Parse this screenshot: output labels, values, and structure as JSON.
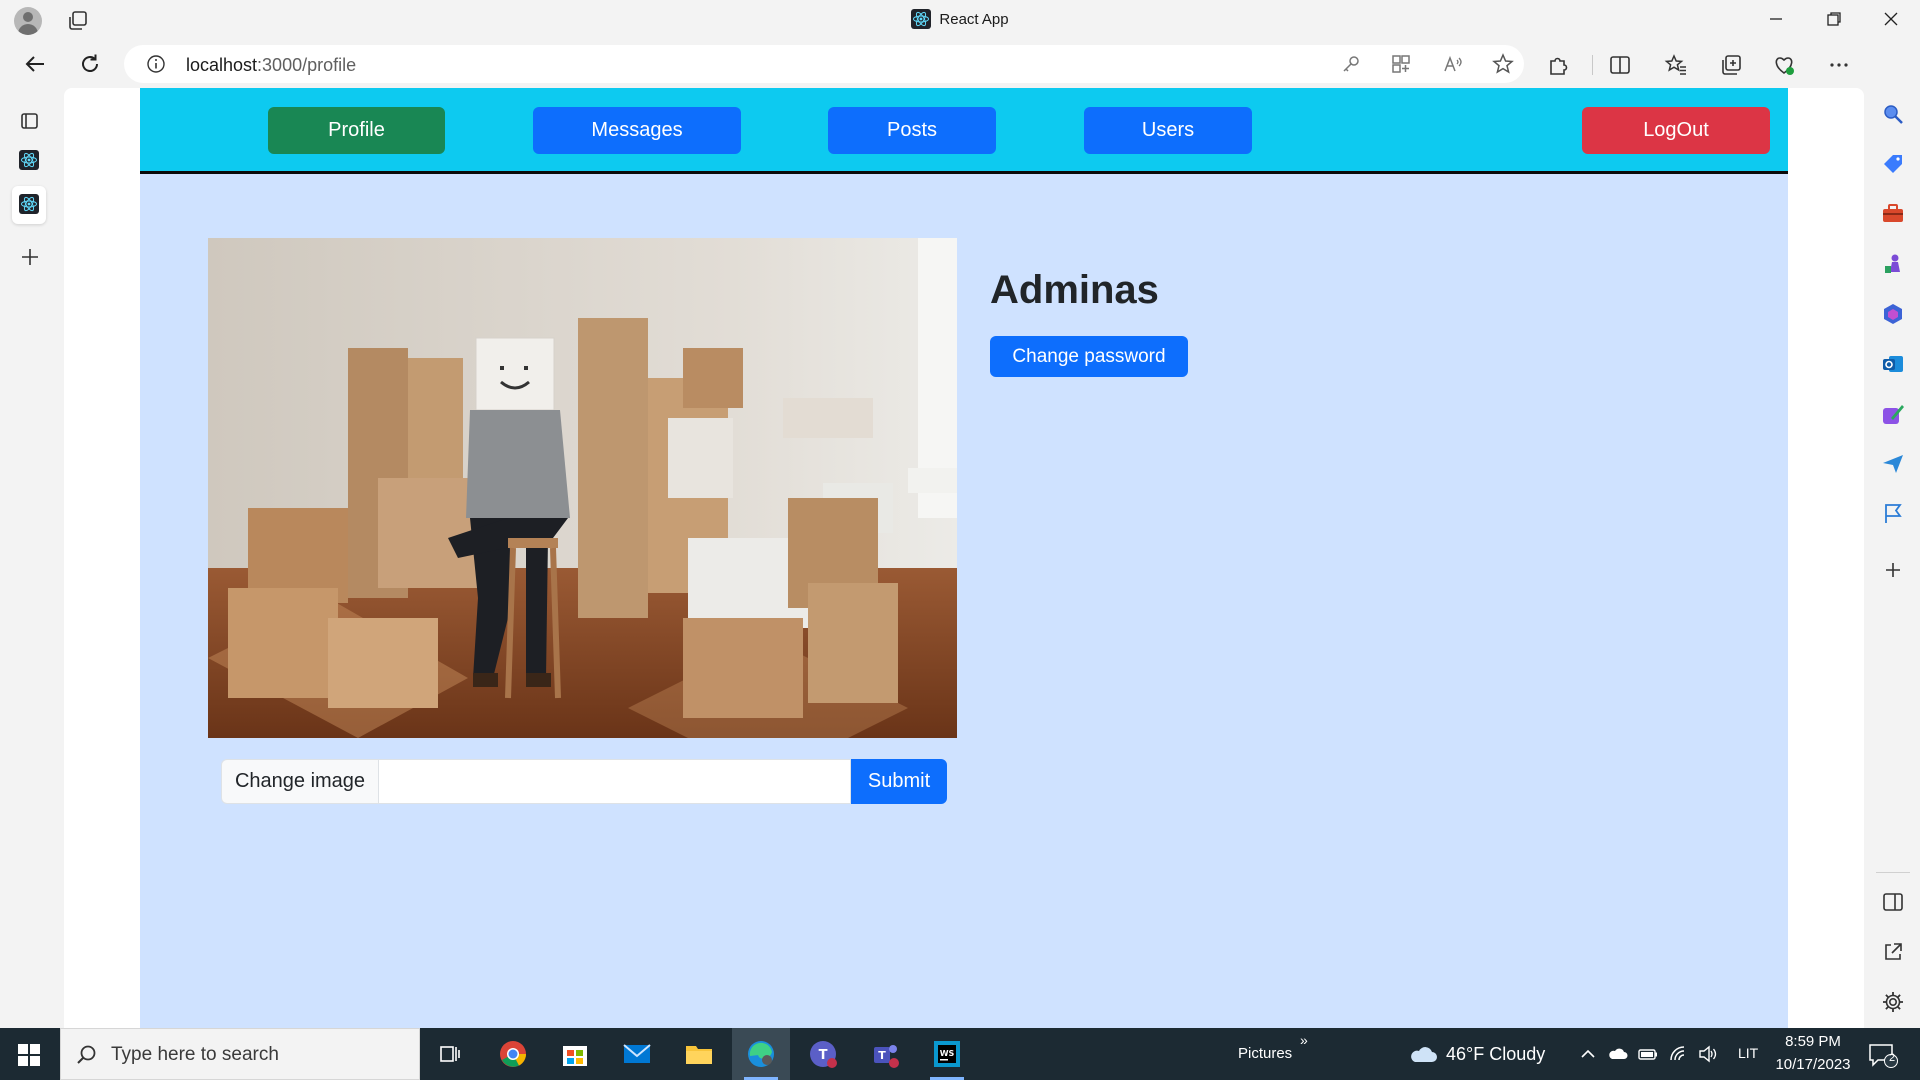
{
  "window": {
    "title": "React App"
  },
  "browser": {
    "url_host": "localhost",
    "url_path": ":3000/profile"
  },
  "app_nav": {
    "profile": "Profile",
    "messages": "Messages",
    "posts": "Posts",
    "users": "Users",
    "logout": "LogOut"
  },
  "profile": {
    "username": "Adminas",
    "change_password": "Change password",
    "change_image_label": "Change image",
    "file_value": "",
    "submit": "Submit"
  },
  "taskbar": {
    "search_placeholder": "Type here to search",
    "pictures_label": "Pictures",
    "weather": "46°F  Cloudy",
    "language": "LIT",
    "time": "8:59 PM",
    "date": "10/17/2023",
    "notification_count": "2"
  },
  "colors": {
    "nav_bg": "#0dcaf0",
    "page_bg": "#cfe2ff",
    "primary": "#0d6efd",
    "success": "#198754",
    "danger": "#dc3545"
  }
}
